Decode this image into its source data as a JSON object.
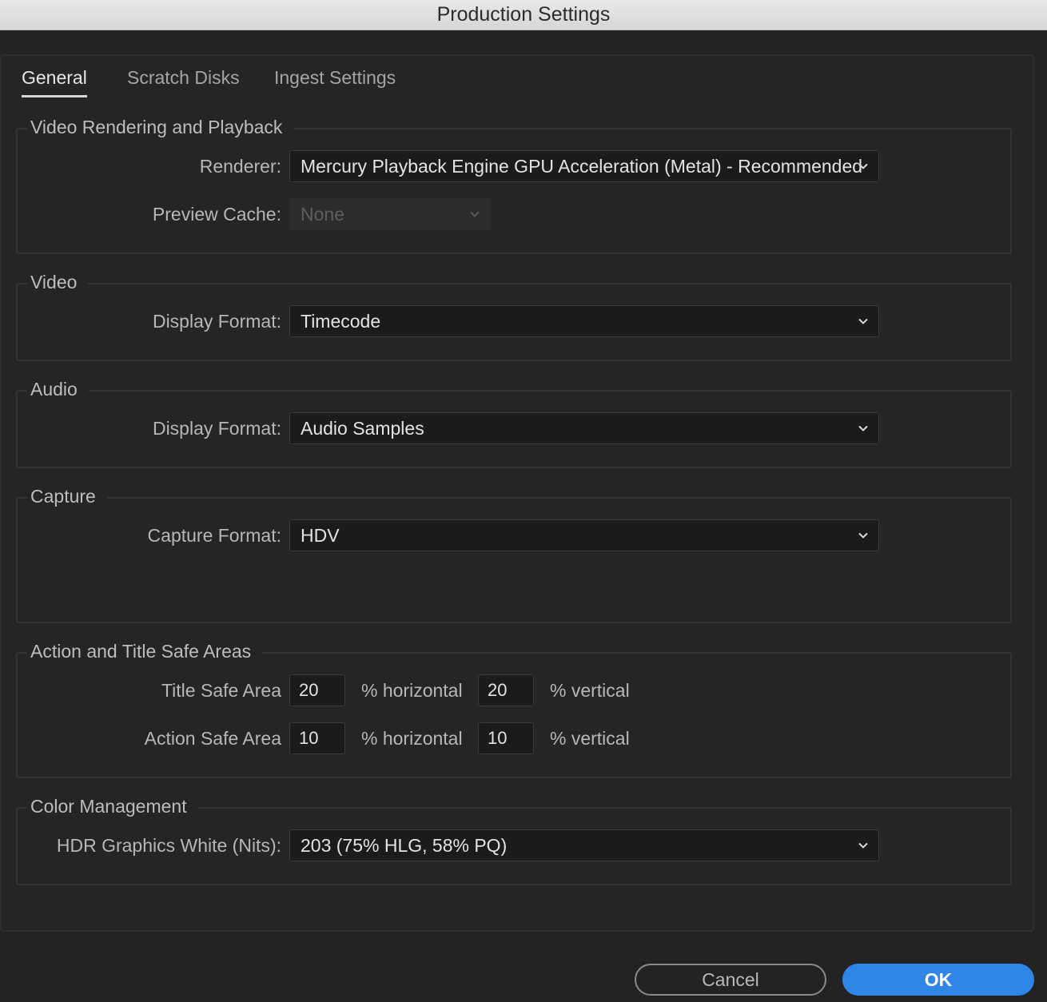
{
  "window": {
    "title": "Production Settings"
  },
  "tabs": [
    {
      "label": "General",
      "active": true
    },
    {
      "label": "Scratch Disks",
      "active": false
    },
    {
      "label": "Ingest Settings",
      "active": false
    }
  ],
  "video_rendering": {
    "title": "Video Rendering and Playback",
    "renderer_label": "Renderer:",
    "renderer_value": "Mercury Playback Engine GPU Acceleration (Metal) - Recommended",
    "preview_cache_label": "Preview Cache:",
    "preview_cache_value": "None"
  },
  "video": {
    "title": "Video",
    "display_format_label": "Display Format:",
    "display_format_value": "Timecode"
  },
  "audio": {
    "title": "Audio",
    "display_format_label": "Display Format:",
    "display_format_value": "Audio Samples"
  },
  "capture": {
    "title": "Capture",
    "capture_format_label": "Capture Format:",
    "capture_format_value": "HDV"
  },
  "safe_areas": {
    "title": "Action and Title Safe Areas",
    "title_safe_label": "Title Safe Area",
    "title_safe_h": "20",
    "title_safe_v": "20",
    "action_safe_label": "Action Safe Area",
    "action_safe_h": "10",
    "action_safe_v": "10",
    "horizontal_suffix": "% horizontal",
    "vertical_suffix": "% vertical"
  },
  "color_management": {
    "title": "Color Management",
    "hdr_label": "HDR Graphics White (Nits):",
    "hdr_value": "203 (75% HLG, 58% PQ)"
  },
  "buttons": {
    "cancel": "Cancel",
    "ok": "OK"
  },
  "icons": {
    "dropdown": "chevron-down-icon"
  },
  "colors": {
    "accent": "#2f86e6",
    "background": "#232323"
  }
}
